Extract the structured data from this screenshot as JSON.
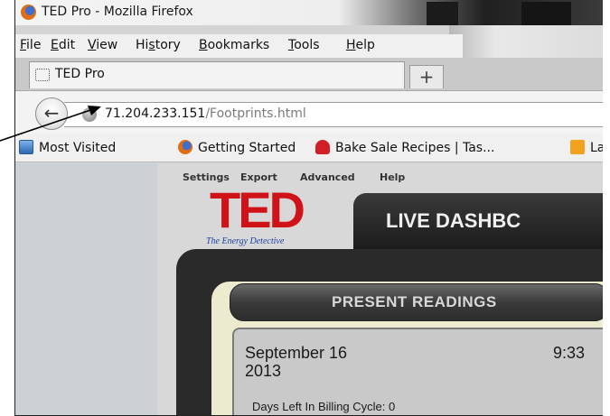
{
  "window": {
    "title": "TED Pro - Mozilla Firefox"
  },
  "menubar": {
    "items": [
      {
        "accel": "F",
        "rest": "ile"
      },
      {
        "accel": "E",
        "rest": "dit"
      },
      {
        "accel": "V",
        "rest": "iew"
      },
      {
        "pre": "Hi",
        "accel": "s",
        "rest": "tory"
      },
      {
        "accel": "B",
        "rest": "ookmarks"
      },
      {
        "accel": "T",
        "rest": "ools"
      },
      {
        "accel": "H",
        "rest": "elp"
      }
    ]
  },
  "tabs": [
    {
      "label": "TED Pro",
      "icon": "blank-page-icon"
    }
  ],
  "new_tab_symbol": "+",
  "nav": {
    "back_symbol": "←",
    "url_host": "71.204.233.151",
    "url_path": "/Footprints.html"
  },
  "bookmarks": [
    {
      "label": "Most Visited",
      "icon": "most-visited-icon"
    },
    {
      "label": "Getting Started",
      "icon": "firefox-icon"
    },
    {
      "label": "Bake Sale Recipes | Tas...",
      "icon": "bake-sale-icon"
    },
    {
      "label": "La",
      "icon": "rss-icon"
    }
  ],
  "ted": {
    "menu": [
      "Settings",
      "Export",
      "Advanced",
      "Help"
    ],
    "logo_text": "TED",
    "logo_sub": "The Energy Detective",
    "dashboard_title": "LIVE DASHBC",
    "present_readings": "PRESENT READINGS",
    "date_line1": "September 16",
    "date_line2": "2013",
    "time": "9:33",
    "billing": "Days Left In Billing Cycle: 0"
  },
  "colors": {
    "ted_red": "#d01219",
    "ted_blue": "#1f3fa5",
    "panel_dark": "#2a2a2a",
    "panel_cream": "#ecebd0"
  }
}
